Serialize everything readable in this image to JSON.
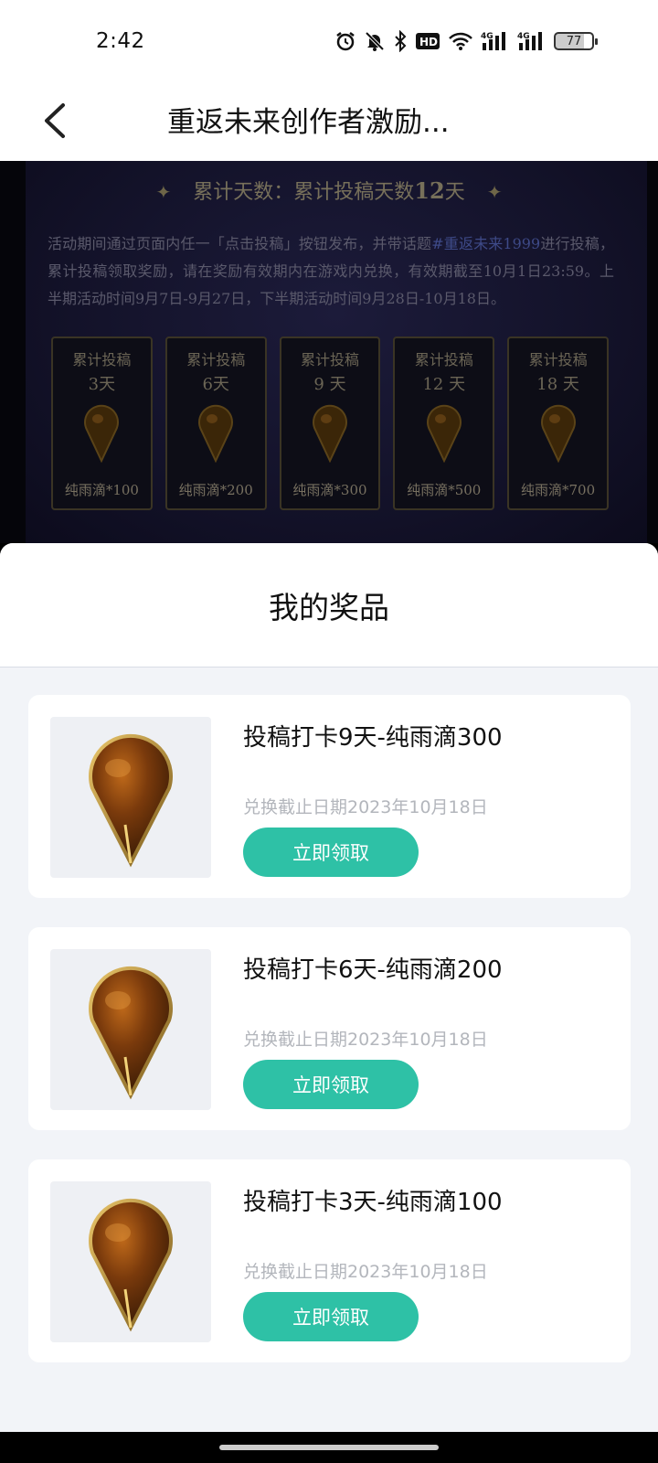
{
  "status_bar": {
    "time": "2:42",
    "icons": [
      "alarm-icon",
      "mute-icon",
      "bluetooth-icon",
      "hd-voice-icon",
      "wifi-icon",
      "signal-4g-icon",
      "signal-4g-icon"
    ],
    "hd_label": "HD",
    "net1": "4G",
    "net2": "4G",
    "battery": "77"
  },
  "nav": {
    "title": "重返未来创作者激励..."
  },
  "banner": {
    "title_prefix": "累计天数：累计投稿天数",
    "title_days": "12",
    "title_suffix": "天",
    "desc_part1": "活动期间通过页面内任一「点击投稿」按钮发布，并带话题",
    "desc_tag": "#重返未来1999",
    "desc_part2": "进行投稿，累计投稿领取奖励，请在奖励有效期内在游戏内兑换，有效期截至10月1日23:59。上半期活动时间9月7日-9月27日，下半期活动时间9月28日-10月18日。",
    "rewards": [
      {
        "label": "累计投稿",
        "days": "3天",
        "amount": "纯雨滴*100"
      },
      {
        "label": "累计投稿",
        "days": "6天",
        "amount": "纯雨滴*200"
      },
      {
        "label": "累计投稿",
        "days": "9 天",
        "amount": "纯雨滴*300"
      },
      {
        "label": "累计投稿",
        "days": "12 天",
        "amount": "纯雨滴*500"
      },
      {
        "label": "累计投稿",
        "days": "18 天",
        "amount": "纯雨滴*700"
      }
    ]
  },
  "sheet": {
    "title": "我的奖品",
    "prizes": [
      {
        "name": "投稿打卡9天-纯雨滴300",
        "deadline": "兑换截止日期2023年10月18日",
        "button": "立即领取"
      },
      {
        "name": "投稿打卡6天-纯雨滴200",
        "deadline": "兑换截止日期2023年10月18日",
        "button": "立即领取"
      },
      {
        "name": "投稿打卡3天-纯雨滴100",
        "deadline": "兑换截止日期2023年10月18日",
        "button": "立即领取"
      }
    ]
  },
  "colors": {
    "accent": "#2ec1a6",
    "sheet_bg": "#f2f4f8",
    "deadline_text": "#b3b6bc"
  }
}
